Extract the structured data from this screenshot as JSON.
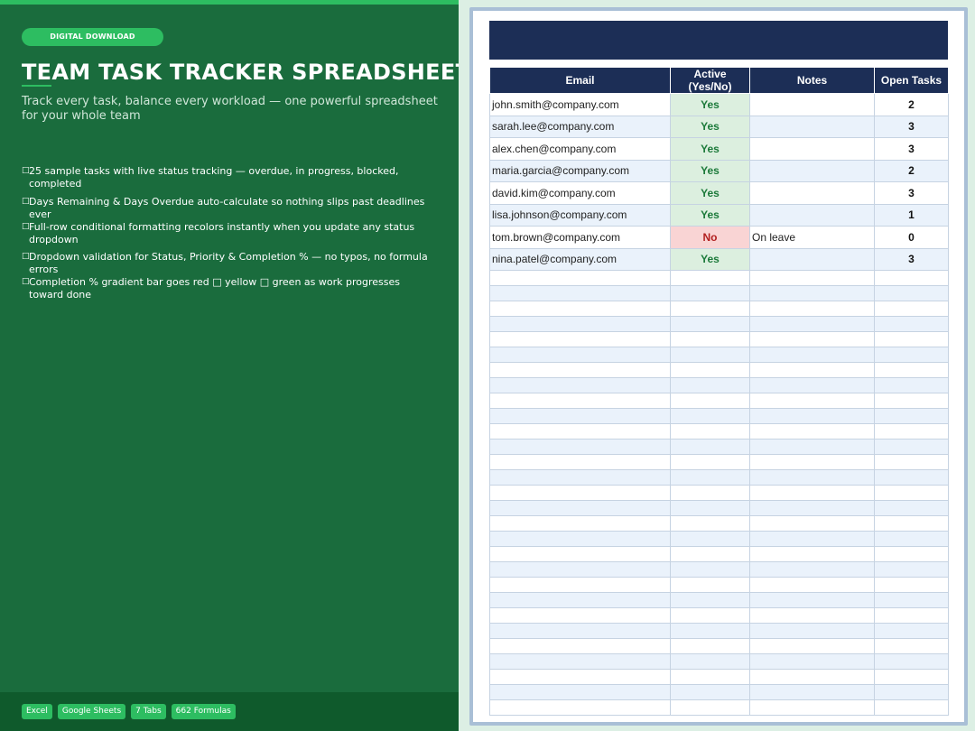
{
  "promo": {
    "badge": "DIGITAL DOWNLOAD",
    "title": "TEAM TASK TRACKER SPREADSHEET",
    "subtitle": "Track every task, balance every workload — one powerful spreadsheet for your whole team",
    "features": [
      "25 sample tasks with live status tracking — overdue, in progress, blocked, completed",
      "Days Remaining & Days Overdue auto-calculate so nothing slips past deadlines ever",
      "Full-row conditional formatting recolors instantly when you update any status dropdown",
      "Dropdown validation for Status, Priority & Completion % — no typos, no formula errors",
      "Completion % gradient bar goes red □ yellow □ green as work progresses toward done"
    ],
    "bullet_glyph": "□",
    "tags": [
      "Excel",
      "Google Sheets",
      "7 Tabs",
      "662 Formulas"
    ]
  },
  "sheet": {
    "columns": [
      "Email",
      "Active (Yes/No)",
      "Notes",
      "Open Tasks"
    ],
    "rows": [
      {
        "email": "john.smith@company.com",
        "active": "Yes",
        "notes": "",
        "open": "2"
      },
      {
        "email": "sarah.lee@company.com",
        "active": "Yes",
        "notes": "",
        "open": "3"
      },
      {
        "email": "alex.chen@company.com",
        "active": "Yes",
        "notes": "",
        "open": "3"
      },
      {
        "email": "maria.garcia@company.com",
        "active": "Yes",
        "notes": "",
        "open": "2"
      },
      {
        "email": "david.kim@company.com",
        "active": "Yes",
        "notes": "",
        "open": "3"
      },
      {
        "email": "lisa.johnson@company.com",
        "active": "Yes",
        "notes": "",
        "open": "1"
      },
      {
        "email": "tom.brown@company.com",
        "active": "No",
        "notes": "On leave",
        "open": "0"
      },
      {
        "email": "nina.patel@company.com",
        "active": "Yes",
        "notes": "",
        "open": "3"
      }
    ],
    "empty_rows": 29
  },
  "colors": {
    "panel_green": "#1a6c3d",
    "accent_green": "#2dbd61",
    "header_navy": "#1c2e56",
    "yes_fill": "#dcefdf",
    "no_fill": "#f9d4d4"
  }
}
